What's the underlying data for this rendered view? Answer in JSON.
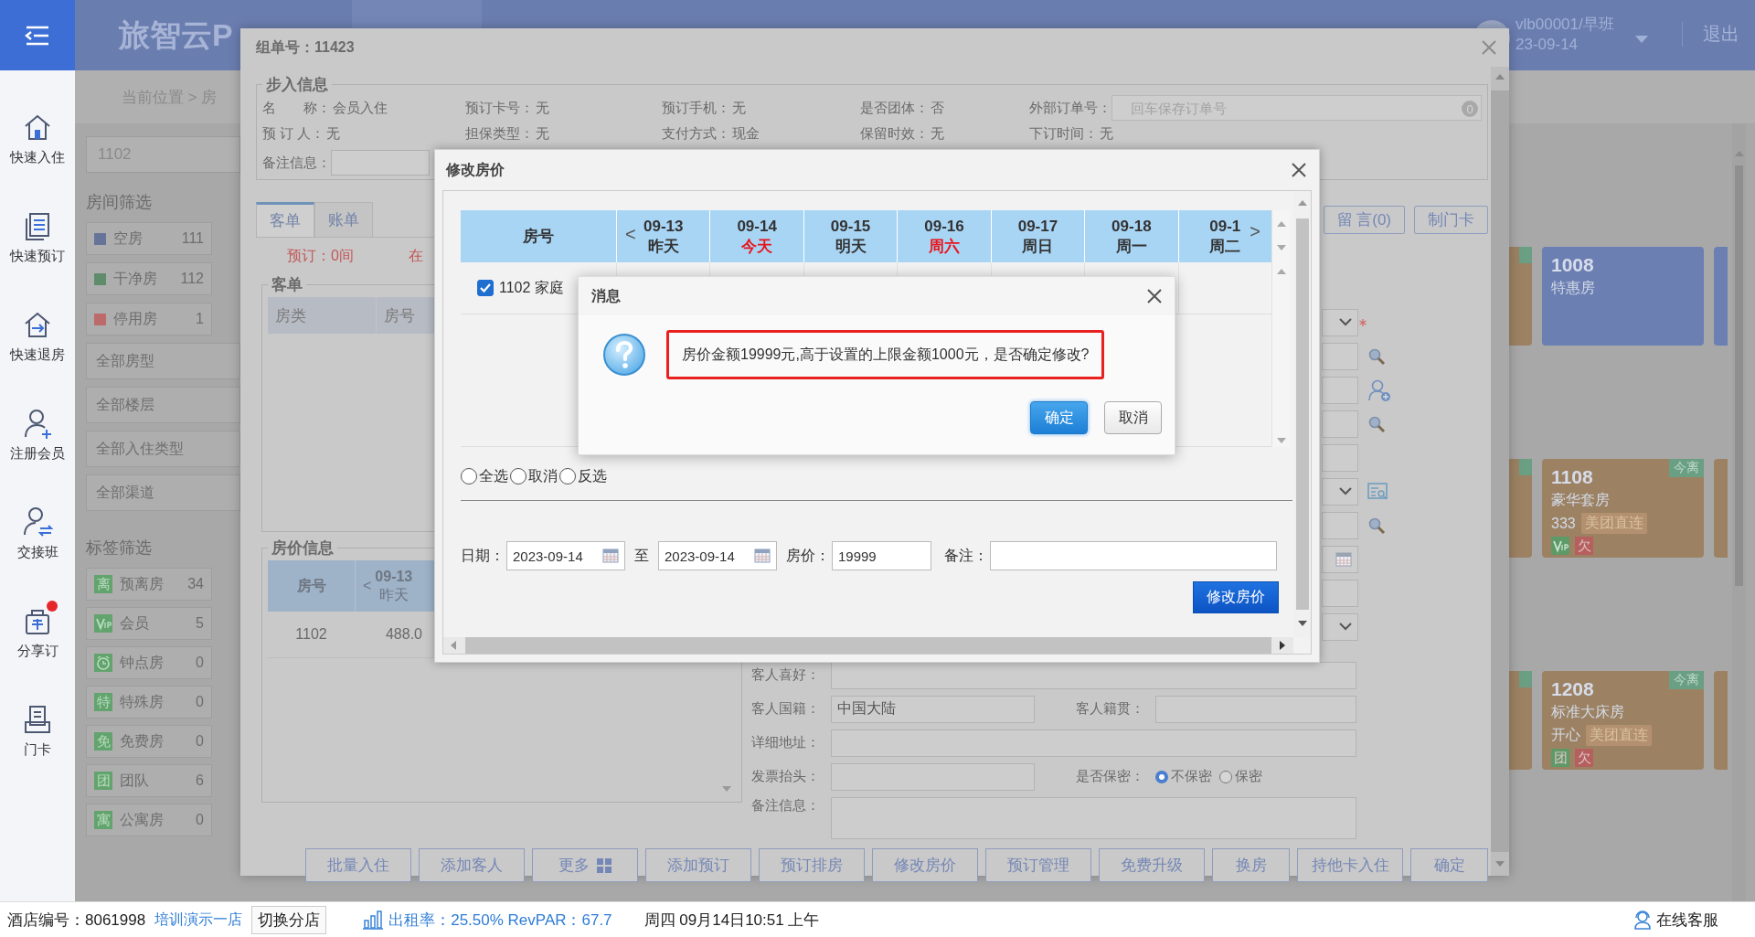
{
  "sidebar": {
    "items": [
      {
        "label": "快速入住",
        "alert": false
      },
      {
        "label": "快速预订",
        "alert": false
      },
      {
        "label": "快速退房",
        "alert": false
      },
      {
        "label": "注册会员",
        "alert": false
      },
      {
        "label": "交接班",
        "alert": false
      },
      {
        "label": "分享订",
        "alert": true
      },
      {
        "label": "门卡",
        "alert": false
      }
    ]
  },
  "topbar": {
    "logo": "旅智云P",
    "user": "vlb00001/早班",
    "date": "23-09-14",
    "logout": "退出",
    "breadcrumb": "当前位置 > 房"
  },
  "filters": {
    "search": "1102",
    "room_title": "房间筛选",
    "statuses": [
      {
        "label": "空房",
        "count": "111",
        "color": "#66749a"
      },
      {
        "label": "干净房",
        "count": "112",
        "color": "#5f8d6c"
      },
      {
        "label": "停用房",
        "count": "1",
        "color": "#bd6a6a"
      }
    ],
    "dropdowns": [
      "全部房型",
      "全部楼层",
      "全部入住类型",
      "全部渠道"
    ],
    "tag_title": "标签筛选",
    "tags": [
      {
        "kind": "text",
        "badge": "离",
        "label": "预离房",
        "count": "34"
      },
      {
        "kind": "vip",
        "label": "会员",
        "count": "5"
      },
      {
        "kind": "clock",
        "label": "钟点房",
        "count": "0"
      },
      {
        "kind": "text",
        "badge": "特",
        "label": "特殊房",
        "count": "0"
      },
      {
        "kind": "text",
        "badge": "免",
        "label": "免费房",
        "count": "0"
      },
      {
        "kind": "text",
        "badge": "团",
        "label": "团队",
        "count": "6"
      },
      {
        "kind": "text",
        "badge": "寓",
        "label": "公寓房",
        "count": "0"
      }
    ]
  },
  "room_board": {
    "cards": [
      {
        "number": "1008",
        "type": "特惠房",
        "color": "#6b7fb2"
      },
      {
        "number": "1108",
        "type": "豪华套房",
        "guest": "333",
        "channel": "美团直连",
        "leaving": "今离",
        "color": "#9c8262",
        "tags": [
          {
            "kind": "vip",
            "color": "#5d9a68"
          },
          {
            "kind": "text",
            "text": "欠",
            "color": "#b65f5f"
          }
        ]
      },
      {
        "number": "1208",
        "type": "标准大床房",
        "guest": "开心",
        "channel": "美团直连",
        "leaving": "今离",
        "color": "#9c8262",
        "tags": [
          {
            "kind": "text",
            "text": "团",
            "color": "#5d9a68"
          },
          {
            "kind": "text",
            "text": "欠",
            "color": "#b65f5f"
          }
        ]
      }
    ]
  },
  "group_dialog": {
    "title": "组单号：11423",
    "section_title": "步入信息",
    "info": [
      {
        "label": "名　　称：",
        "value": "会员入住"
      },
      {
        "label": "预订卡号：",
        "value": "无"
      },
      {
        "label": "预订手机：",
        "value": "无"
      },
      {
        "label": "是否团体：",
        "value": "否"
      },
      {
        "label": "预 订 人：",
        "value": "无"
      },
      {
        "label": "担保类型：",
        "value": "无"
      },
      {
        "label": "支付方式：",
        "value": "现金"
      },
      {
        "label": "保留时效：",
        "value": "无"
      },
      {
        "label": "下订时间：",
        "value": "无"
      }
    ],
    "external_order": {
      "label": "外部订单号：",
      "placeholder": "回车保存订单号",
      "count": "0"
    },
    "remark_label": "备注信息：",
    "tabs": [
      {
        "label": "客单",
        "selected": true
      },
      {
        "label": "账单",
        "selected": false
      }
    ],
    "booked": "预订：0间",
    "in_house": "在",
    "guest_section": {
      "title": "客单",
      "columns": [
        "房类",
        "房号"
      ]
    },
    "rate_section": {
      "title": "房价信息",
      "room_header": "房号",
      "prev": "<",
      "days": [
        {
          "date": "09-13",
          "day": "昨天"
        }
      ],
      "rows": [
        {
          "room": "1102",
          "price": "488.0"
        }
      ]
    },
    "message_button": "留 言(0)",
    "card_button": "制门卡",
    "guest_form": {
      "hobby_label": "客人喜好：",
      "nationality_label": "客人国籍：",
      "nationality": "中国大陆",
      "origin_label": "客人籍贯：",
      "address_label": "详细地址：",
      "invoice_label": "发票抬头：",
      "privacy_label": "是否保密：",
      "privacy_options": [
        {
          "label": "不保密",
          "selected": true
        },
        {
          "label": "保密",
          "selected": false
        }
      ],
      "remark_label": "备注信息："
    },
    "buttons": [
      {
        "label": "批量入住",
        "kind": "plain"
      },
      {
        "label": "添加客人",
        "kind": "plain"
      },
      {
        "label": "更多",
        "kind": "more"
      },
      {
        "label": "添加预订",
        "kind": "plain"
      },
      {
        "label": "预订排房",
        "kind": "plain"
      },
      {
        "label": "修改房价",
        "kind": "plain"
      },
      {
        "label": "预订管理",
        "kind": "plain"
      },
      {
        "label": "免费升级",
        "kind": "plain"
      },
      {
        "label": "换房",
        "kind": "plain"
      },
      {
        "label": "持他卡入住",
        "kind": "plain"
      },
      {
        "label": "确定",
        "kind": "plain"
      }
    ]
  },
  "price_dialog": {
    "title": "修改房价",
    "room_header": "房号",
    "prev": "<",
    "next": ">",
    "days": [
      {
        "date": "09-13",
        "day": "昨天",
        "highlight": false
      },
      {
        "date": "09-14",
        "day": "今天",
        "highlight": true
      },
      {
        "date": "09-15",
        "day": "明天",
        "highlight": false
      },
      {
        "date": "09-16",
        "day": "周六",
        "highlight": true
      },
      {
        "date": "09-17",
        "day": "周日",
        "highlight": false
      },
      {
        "date": "09-18",
        "day": "周一",
        "highlight": false
      },
      {
        "date": "09-1",
        "day": "周二",
        "highlight": false
      }
    ],
    "rows": [
      {
        "label": "1102 家庭",
        "checked": true
      }
    ],
    "selection": [
      {
        "label": "全选",
        "selected": false
      },
      {
        "label": "取消",
        "selected": false
      },
      {
        "label": "反选",
        "selected": false
      }
    ],
    "date_label": "日期：",
    "from": "2023-09-14",
    "to_label": "至",
    "to": "2023-09-14",
    "price_label": "房价：",
    "price": "19999",
    "remark_label": "备注：",
    "submit": "修改房价"
  },
  "message_dialog": {
    "title": "消息",
    "text": "房价金额19999元,高于设置的上限金额1000元，是否确定修改?",
    "buttons": [
      {
        "label": "确定",
        "kind": "primary"
      },
      {
        "label": "取消",
        "kind": "default"
      }
    ]
  },
  "status_bar": {
    "hotel": "酒店编号：8061998",
    "hotel_name": "培训演示一店",
    "switch": "切换分店",
    "occupancy": "出租率：25.50% RevPAR：67.7",
    "datetime": "周四 09月14日10:51 上午",
    "support": "在线客服"
  }
}
